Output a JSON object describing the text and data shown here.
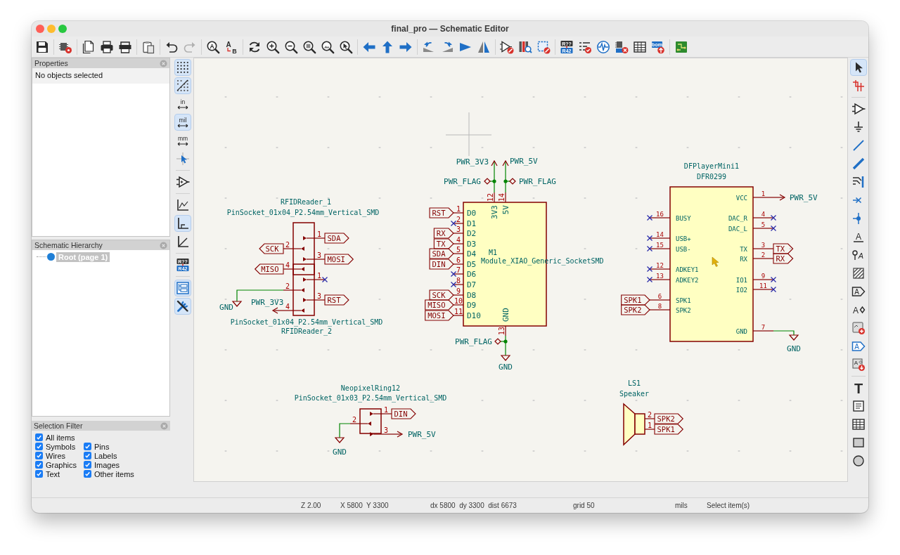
{
  "window": {
    "title": "final_pro — Schematic Editor"
  },
  "main_toolbar": {
    "groups": [
      [
        {
          "disabled": false
        }
      ],
      [
        {
          "disabled": false
        }
      ],
      [
        {
          "disabled": false
        },
        {
          "disabled": false
        },
        {
          "disabled": false
        }
      ],
      [
        {
          "disabled": false
        }
      ],
      [
        {
          "disabled": false
        },
        {
          "disabled": true
        }
      ],
      [
        {
          "disabled": false,
          "glyphs": [
            "A"
          ]
        },
        {
          "disabled": false,
          "glyphs": [
            "A",
            "B"
          ]
        }
      ],
      [
        {
          "disabled": false
        },
        {
          "disabled": false
        },
        {
          "disabled": false
        },
        {
          "disabled": false
        },
        {
          "disabled": false
        },
        {
          "disabled": false
        }
      ],
      [
        {
          "disabled": false
        },
        {
          "disabled": false
        },
        {
          "disabled": false
        }
      ],
      [
        {
          "disabled": false
        },
        {
          "disabled": false
        },
        {
          "disabled": false
        },
        {
          "disabled": false
        }
      ],
      [
        {
          "disabled": false
        },
        {
          "disabled": false
        },
        {
          "disabled": false
        }
      ],
      [
        {
          "disabled": false,
          "glyphs": [
            "R??",
            "R42"
          ]
        },
        {
          "disabled": false
        },
        {
          "disabled": false
        },
        {
          "disabled": false
        },
        {
          "disabled": false
        },
        {
          "disabled": false,
          "glyphs": [
            "bom"
          ]
        }
      ],
      [
        {
          "disabled": false
        }
      ]
    ]
  },
  "properties_panel": {
    "title": "Properties",
    "message": "No objects selected"
  },
  "hierarchy_panel": {
    "title": "Schematic Hierarchy",
    "items": [
      {
        "label": "Root (page 1)",
        "selected": true
      }
    ]
  },
  "selection_filter": {
    "title": "Selection Filter",
    "options": [
      {
        "label": "All items",
        "checked": true
      },
      {
        "label": "Symbols",
        "checked": true
      },
      {
        "label": "Pins",
        "checked": true
      },
      {
        "label": "Wires",
        "checked": true
      },
      {
        "label": "Labels",
        "checked": true
      },
      {
        "label": "Graphics",
        "checked": true
      },
      {
        "label": "Images",
        "checked": true
      },
      {
        "label": "Text",
        "checked": true
      },
      {
        "label": "Other items",
        "checked": true
      }
    ]
  },
  "view_toolbar": {
    "groups": [
      [
        {
          "selected": true
        },
        {
          "selected": true
        },
        {
          "selected": false,
          "glyphs": [
            "in"
          ]
        },
        {
          "selected": true,
          "glyphs": [
            "mil"
          ]
        },
        {
          "selected": false,
          "glyphs": [
            "mm"
          ]
        },
        {
          "selected": false
        }
      ],
      [
        {
          "selected": false
        }
      ],
      [
        {
          "selected": false
        },
        {
          "selected": true
        },
        {
          "selected": false
        }
      ],
      [
        {
          "selected": false,
          "glyphs": [
            "R??",
            "R42"
          ]
        }
      ],
      [
        {
          "selected": true
        },
        {
          "selected": true
        }
      ]
    ]
  },
  "schematic": {
    "symbols": [
      {
        "kind": "socket",
        "reference": "RFIDReader_1",
        "value": "PinSocket_01x04_P2.54mm_Vertical_SMD",
        "pins": [
          {
            "number": "1",
            "attached": [
              {
                "kind": "label",
                "text": "SDA",
                "points_left": false
              }
            ]
          },
          {
            "number": "2",
            "attached": [
              {
                "kind": "label",
                "text": "SCK",
                "points_left": true
              }
            ]
          },
          {
            "number": "3",
            "attached": [
              {
                "kind": "label",
                "text": "MOSI",
                "points_left": false
              }
            ]
          },
          {
            "number": "4",
            "attached": [
              {
                "kind": "label",
                "text": "MISO",
                "points_left": true
              }
            ]
          }
        ]
      },
      {
        "kind": "socket",
        "reference": "RFIDReader_2",
        "value": "PinSocket_01x04_P2.54mm_Vertical_SMD",
        "pins": [
          {
            "number": "1",
            "attached": [
              {
                "kind": "no_connect"
              }
            ]
          },
          {
            "number": "2",
            "attached": [
              {
                "kind": "ground",
                "text": "GND"
              }
            ]
          },
          {
            "number": "3",
            "attached": [
              {
                "kind": "label",
                "text": "RST",
                "points_left": false
              }
            ]
          },
          {
            "number": "4",
            "attached": [
              {
                "kind": "power",
                "text": "PWR_3V3"
              }
            ]
          }
        ]
      },
      {
        "kind": "module",
        "reference": "M1",
        "value": "Module_XIAO_Generic_SocketSMD",
        "pins": [
          {
            "number": "1",
            "name": "D0",
            "attached": [
              {
                "kind": "label",
                "text": "RST",
                "points_left": false
              }
            ]
          },
          {
            "number": "2",
            "name": "D1",
            "attached": [
              {
                "kind": "no_connect"
              }
            ]
          },
          {
            "number": "3",
            "name": "D2",
            "attached": [
              {
                "kind": "label",
                "text": "RX",
                "points_left": false
              }
            ]
          },
          {
            "number": "4",
            "name": "D3",
            "attached": [
              {
                "kind": "label",
                "text": "TX",
                "points_left": false
              }
            ]
          },
          {
            "number": "5",
            "name": "D4",
            "attached": [
              {
                "kind": "label",
                "text": "SDA",
                "points_left": false
              }
            ]
          },
          {
            "number": "6",
            "name": "D5",
            "attached": [
              {
                "kind": "label",
                "text": "DIN",
                "points_left": false
              }
            ]
          },
          {
            "number": "7",
            "name": "D6",
            "attached": [
              {
                "kind": "no_connect"
              }
            ]
          },
          {
            "number": "8",
            "name": "D7",
            "attached": [
              {
                "kind": "no_connect"
              }
            ]
          },
          {
            "number": "9",
            "name": "D8",
            "attached": [
              {
                "kind": "label",
                "text": "SCK",
                "points_left": false
              }
            ]
          },
          {
            "number": "10",
            "name": "D9",
            "attached": [
              {
                "kind": "label",
                "text": "MISO",
                "points_left": false
              }
            ]
          },
          {
            "number": "11",
            "name": "D10",
            "attached": [
              {
                "kind": "label",
                "text": "MOSI",
                "points_left": false
              }
            ]
          },
          {
            "number": "12",
            "name": "3V3",
            "attached": [
              {
                "kind": "power",
                "text": "PWR_3V3"
              },
              {
                "kind": "flag",
                "text": "PWR_FLAG"
              }
            ]
          },
          {
            "number": "14",
            "name": "5V",
            "attached": [
              {
                "kind": "power",
                "text": "PWR_5V"
              },
              {
                "kind": "flag",
                "text": "PWR_FLAG"
              }
            ]
          },
          {
            "number": "13",
            "name": "GND",
            "attached": [
              {
                "kind": "flag",
                "text": "PWR_FLAG"
              },
              {
                "kind": "ground",
                "text": "GND"
              }
            ]
          }
        ]
      },
      {
        "kind": "module",
        "reference": "DFPlayerMini1",
        "value": "DFR0299",
        "pins": [
          {
            "number": "16",
            "name": "BUSY",
            "attached": [
              {
                "kind": "no_connect"
              }
            ]
          },
          {
            "number": "14",
            "name": "USB+",
            "attached": [
              {
                "kind": "no_connect"
              }
            ]
          },
          {
            "number": "15",
            "name": "USB-",
            "attached": [
              {
                "kind": "no_connect"
              }
            ]
          },
          {
            "number": "12",
            "name": "ADKEY1",
            "attached": [
              {
                "kind": "no_connect"
              }
            ]
          },
          {
            "number": "13",
            "name": "ADKEY2",
            "attached": [
              {
                "kind": "no_connect"
              }
            ]
          },
          {
            "number": "6",
            "name": "SPK1",
            "attached": [
              {
                "kind": "label",
                "text": "SPK1",
                "points_left": false
              }
            ]
          },
          {
            "number": "8",
            "name": "SPK2",
            "attached": [
              {
                "kind": "label",
                "text": "SPK2",
                "points_left": false
              }
            ]
          },
          {
            "number": "1",
            "name": "VCC",
            "attached": [
              {
                "kind": "power",
                "text": "PWR_5V"
              }
            ]
          },
          {
            "number": "4",
            "name": "DAC_R",
            "attached": [
              {
                "kind": "no_connect"
              }
            ]
          },
          {
            "number": "5",
            "name": "DAC_L",
            "attached": [
              {
                "kind": "no_connect"
              }
            ]
          },
          {
            "number": "3",
            "name": "TX",
            "attached": [
              {
                "kind": "label",
                "text": "TX",
                "points_left": false
              }
            ]
          },
          {
            "number": "2",
            "name": "RX",
            "attached": [
              {
                "kind": "label",
                "text": "RX",
                "points_left": false
              }
            ]
          },
          {
            "number": "9",
            "name": "IO1",
            "attached": [
              {
                "kind": "no_connect"
              }
            ]
          },
          {
            "number": "11",
            "name": "IO2",
            "attached": [
              {
                "kind": "no_connect"
              }
            ]
          },
          {
            "number": "7",
            "name": "GND",
            "attached": [
              {
                "kind": "ground",
                "text": "GND"
              }
            ]
          }
        ]
      },
      {
        "kind": "socket",
        "reference": "NeopixelRing12",
        "value": "PinSocket_01x03_P2.54mm_Vertical_SMD",
        "pins": [
          {
            "number": "1",
            "attached": [
              {
                "kind": "label",
                "text": "DIN",
                "points_left": false
              }
            ]
          },
          {
            "number": "2",
            "attached": [
              {
                "kind": "ground",
                "text": "GND"
              }
            ]
          },
          {
            "number": "3",
            "attached": [
              {
                "kind": "power",
                "text": "PWR_5V"
              }
            ]
          }
        ]
      },
      {
        "kind": "speaker",
        "reference": "LS1",
        "value": "Speaker",
        "pins": [
          {
            "number": "2",
            "attached": [
              {
                "kind": "label",
                "text": "SPK2",
                "points_left": false
              }
            ]
          },
          {
            "number": "1",
            "attached": [
              {
                "kind": "label",
                "text": "SPK1",
                "points_left": false
              }
            ]
          }
        ]
      }
    ]
  },
  "drawing_toolbar": {
    "groups": [
      [
        {
          "selected": true
        },
        {
          "selected": false
        }
      ],
      [
        {
          "selected": false
        },
        {
          "selected": false
        },
        {
          "selected": false
        },
        {
          "selected": false
        },
        {
          "selected": false
        },
        {
          "selected": false
        },
        {
          "selected": false
        },
        {
          "selected": false,
          "glyphs": [
            "A"
          ]
        },
        {
          "selected": false,
          "glyphs": [
            "A"
          ]
        },
        {
          "selected": false
        },
        {
          "selected": false,
          "glyphs": [
            "A"
          ]
        },
        {
          "selected": false,
          "glyphs": [
            "A"
          ]
        },
        {
          "selected": false
        },
        {
          "selected": false,
          "glyphs": [
            "A"
          ]
        },
        {
          "selected": false,
          "glyphs": [
            "A"
          ]
        }
      ],
      [
        {
          "selected": false,
          "glyphs": [
            "T"
          ]
        },
        {
          "selected": false
        },
        {
          "selected": false
        },
        {
          "selected": false
        },
        {
          "selected": false
        }
      ]
    ]
  },
  "status_bar": {
    "zoom": "Z 2.00",
    "position": "X 5800  Y 3300",
    "delta": "dx 5800  dy 3300  dist 6673",
    "grid": "grid 50",
    "units": "mils",
    "message": "Select item(s)"
  }
}
